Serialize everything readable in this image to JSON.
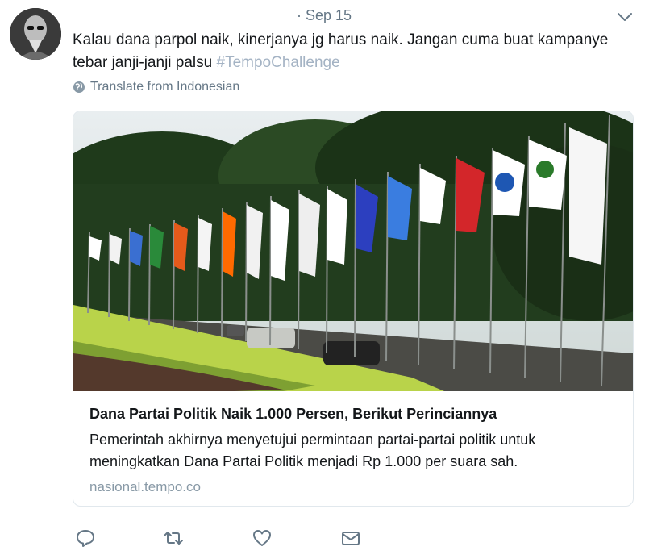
{
  "tweet": {
    "timestamp": "· Sep 15",
    "text": "Kalau dana parpol naik, kinerjanya jg harus naik. Jangan cuma buat kampanye tebar janji-janji palsu ",
    "hashtag": "#TempoChallenge",
    "translate_label": "Translate from Indonesian"
  },
  "card": {
    "title": "Dana Partai Politik Naik 1.000 Persen, Berikut Perinciannya",
    "description": "Pemerintah akhirnya menyetujui permintaan partai-partai politik untuk meningkatkan Dana Partai Politik menjadi Rp 1.000 per suara sah.",
    "domain": "nasional.tempo.co"
  },
  "icons": {
    "more": "chevron-down-icon",
    "translate": "globe-icon",
    "reply": "reply-icon",
    "retweet": "retweet-icon",
    "like": "heart-icon",
    "dm": "envelope-icon"
  },
  "colors": {
    "text": "#14171a",
    "secondary": "#657786",
    "hashtag": "#a4b3c4",
    "border": "#e1e8ed"
  }
}
